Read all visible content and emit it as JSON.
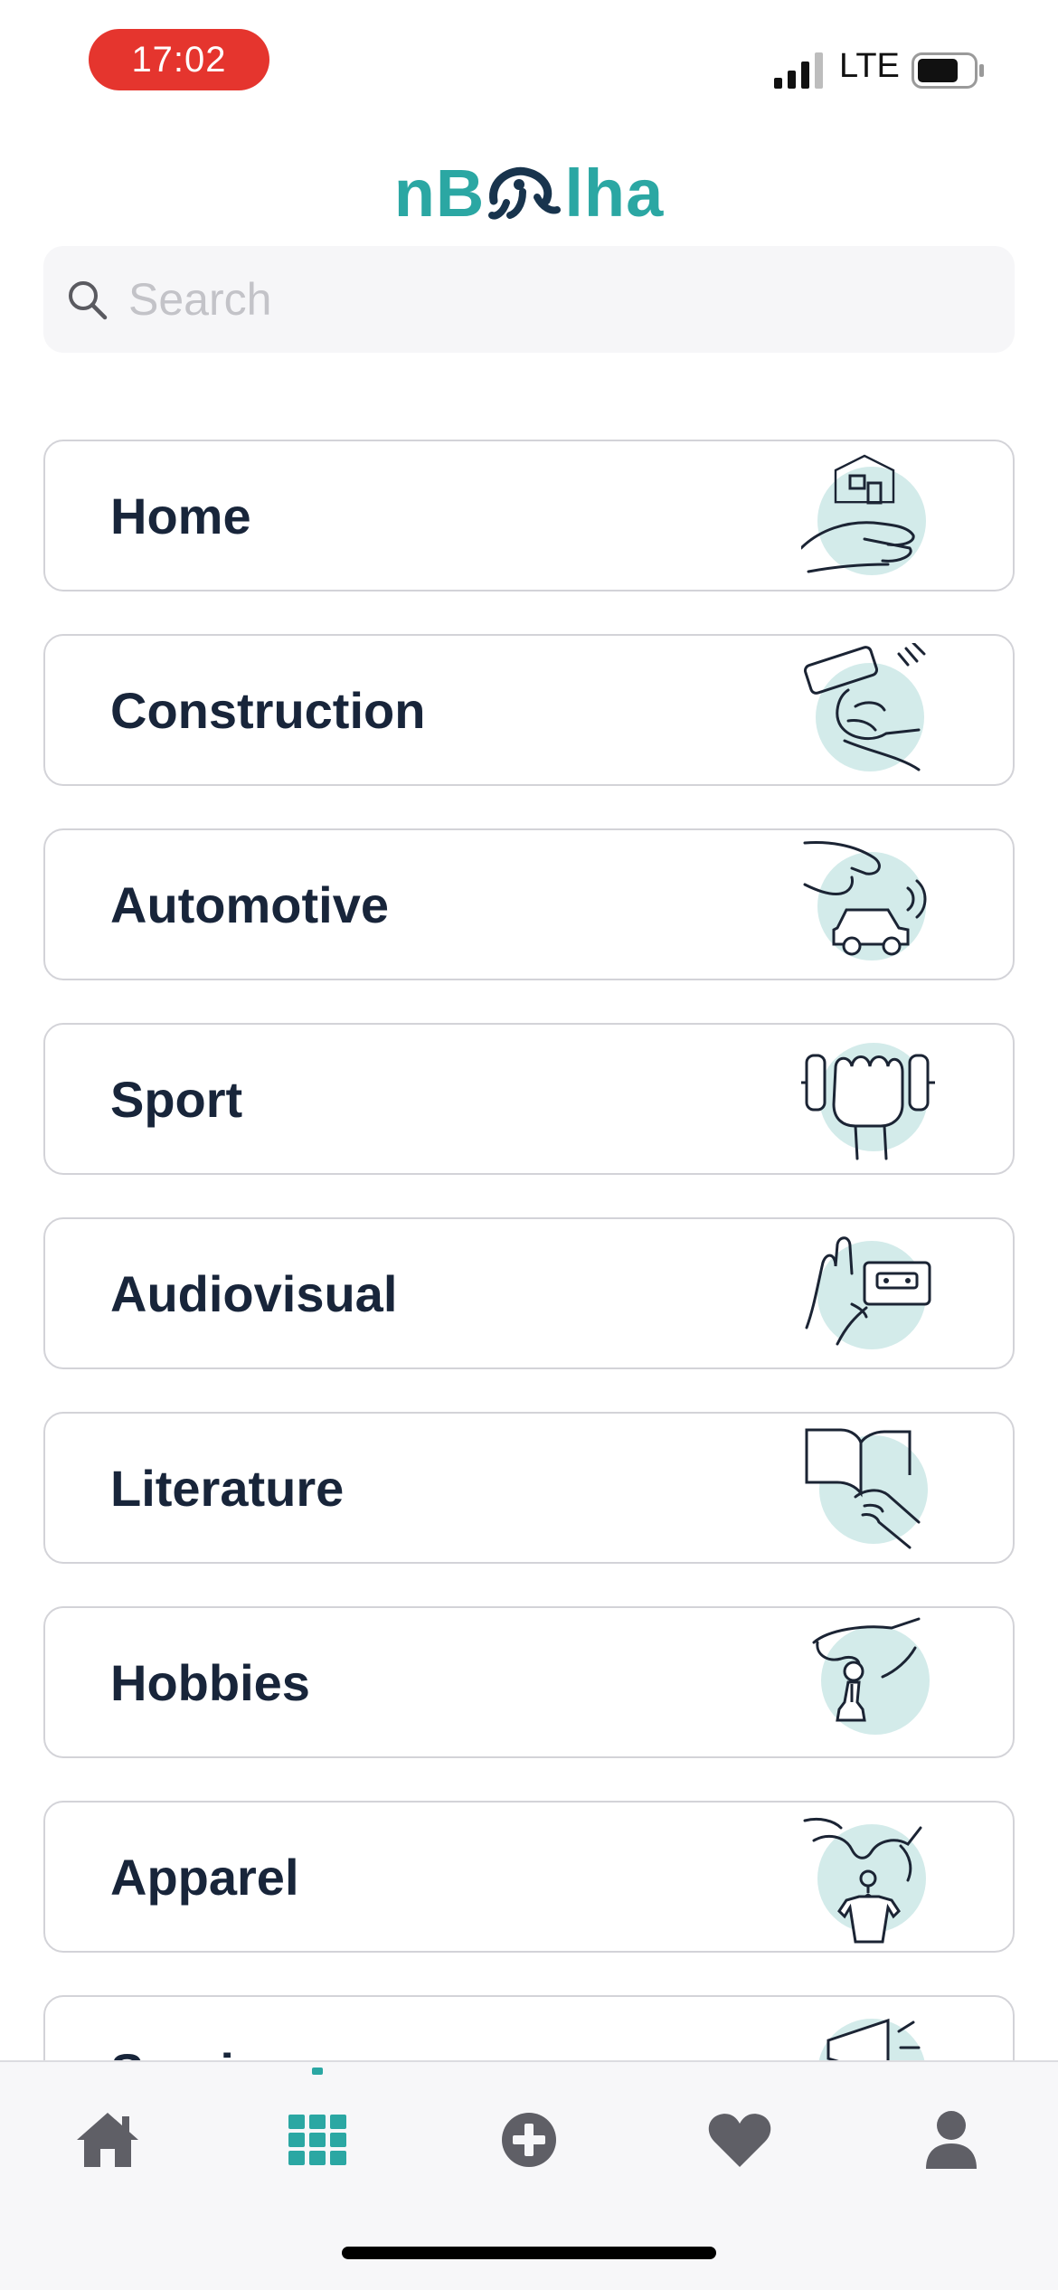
{
  "status_bar": {
    "time": "17:02",
    "network": "LTE"
  },
  "app": {
    "logo_prefix": "nB",
    "logo_suffix": "lha",
    "accent_color": "#2ba7a3"
  },
  "search": {
    "placeholder": "Search",
    "value": ""
  },
  "categories": [
    {
      "label": "Home",
      "icon": "house-in-hand-icon"
    },
    {
      "label": "Construction",
      "icon": "paint-roller-hand-icon"
    },
    {
      "label": "Automotive",
      "icon": "toy-car-hand-icon"
    },
    {
      "label": "Sport",
      "icon": "dumbbell-hand-icon"
    },
    {
      "label": "Audiovisual",
      "icon": "cassette-hand-icon"
    },
    {
      "label": "Literature",
      "icon": "book-hand-icon"
    },
    {
      "label": "Hobbies",
      "icon": "chess-piece-hand-icon"
    },
    {
      "label": "Apparel",
      "icon": "shirt-hanger-hand-icon"
    },
    {
      "label": "Services",
      "icon": "megaphone-hand-icon"
    }
  ],
  "tabbar": {
    "tabs": [
      {
        "name": "home",
        "icon": "home-icon",
        "active": false
      },
      {
        "name": "categories",
        "icon": "grid-icon",
        "active": true
      },
      {
        "name": "add",
        "icon": "plus-circle-icon",
        "active": false
      },
      {
        "name": "favorites",
        "icon": "heart-icon",
        "active": false
      },
      {
        "name": "profile",
        "icon": "user-icon",
        "active": false
      }
    ],
    "active_color": "#2ba7a3",
    "inactive_color": "#5f5f66"
  }
}
